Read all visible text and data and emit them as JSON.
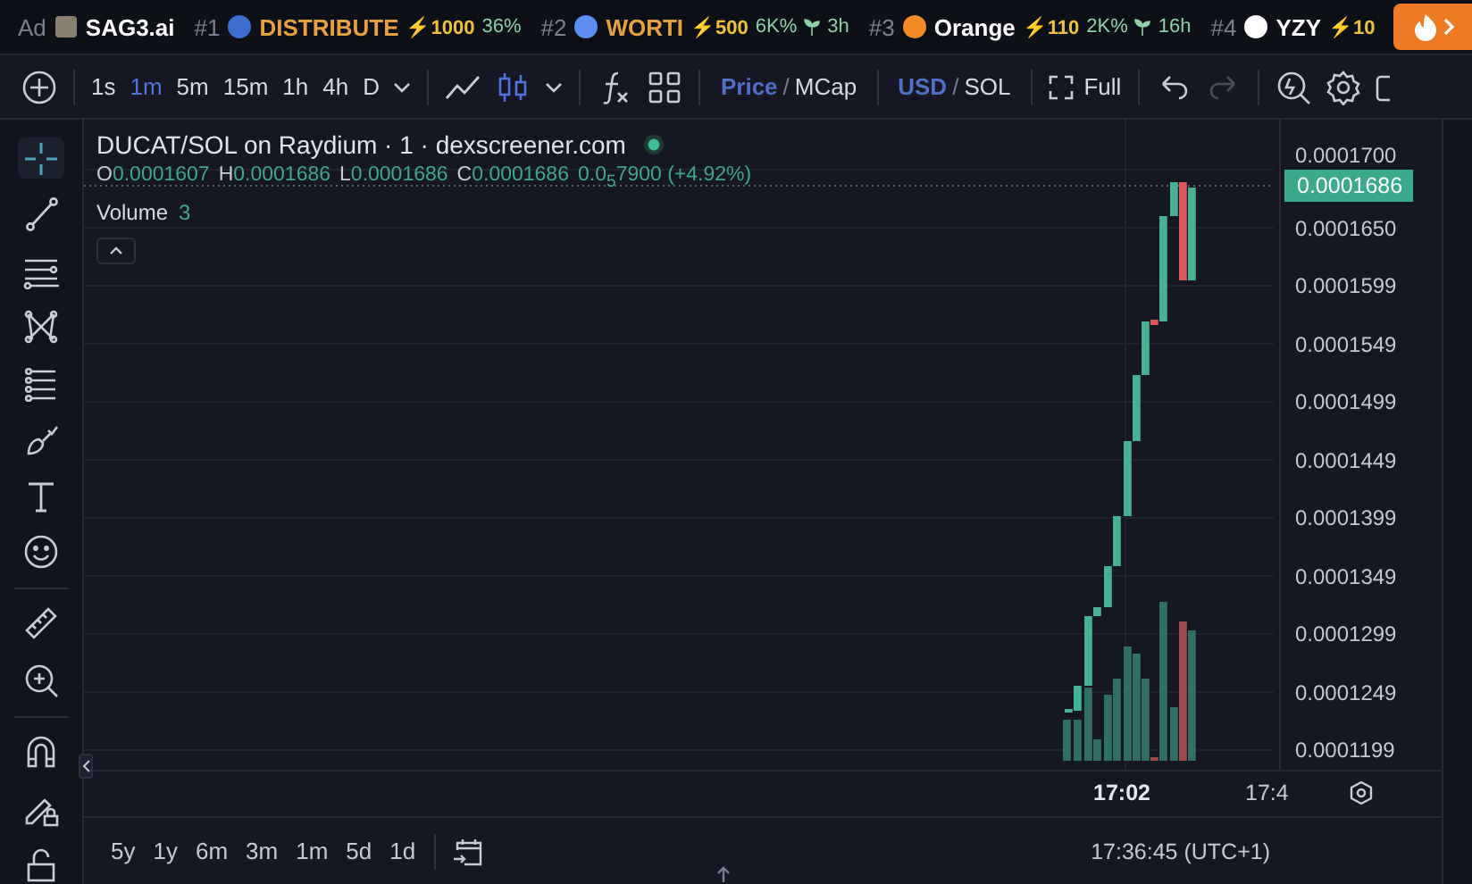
{
  "ticker": {
    "ad_label": "Ad",
    "ad_name": "SAG3.ai",
    "items": [
      {
        "rank": "#1",
        "name": "DISTRIBUTE",
        "boosted": true,
        "boost": "⚡1000",
        "change": "36%"
      },
      {
        "rank": "#2",
        "name": "WORTI",
        "boosted": true,
        "boost": "⚡500",
        "change": "6K%",
        "age": "3h"
      },
      {
        "rank": "#3",
        "name": "Orange",
        "boosted": false,
        "boost": "⚡110",
        "change": "2K%",
        "age": "16h"
      },
      {
        "rank": "#4",
        "name": "YZY",
        "boosted": false,
        "boost": "⚡10"
      }
    ]
  },
  "toolbar": {
    "intervals": [
      {
        "label": "1s",
        "selected": false
      },
      {
        "label": "1m",
        "selected": true
      },
      {
        "label": "5m",
        "selected": false
      },
      {
        "label": "15m",
        "selected": false
      },
      {
        "label": "1h",
        "selected": false
      },
      {
        "label": "4h",
        "selected": false
      },
      {
        "label": "D",
        "selected": false
      }
    ],
    "chart_types": [
      {
        "kind": "line",
        "selected": false
      },
      {
        "kind": "candles",
        "selected": true
      }
    ],
    "price_toggle": {
      "options": [
        {
          "label": "Price",
          "selected": true
        },
        {
          "label": "MCap",
          "selected": false
        }
      ],
      "separator": "/"
    },
    "currency_toggle": {
      "options": [
        {
          "label": "USD",
          "selected": true
        },
        {
          "label": "SOL",
          "selected": false
        }
      ],
      "separator": "/"
    },
    "fullscreen": "Full",
    "redo_disabled": true
  },
  "tools": [
    {
      "kind": "crosshair",
      "selected": true
    },
    {
      "kind": "trend-line",
      "selected": false
    },
    {
      "kind": "horizontal-lines",
      "selected": false
    },
    {
      "kind": "pattern",
      "selected": false
    },
    {
      "kind": "fib",
      "selected": false
    },
    {
      "kind": "brush",
      "selected": false
    },
    {
      "kind": "text",
      "selected": false
    },
    {
      "kind": "emoji",
      "selected": false
    },
    {
      "kind": "ruler",
      "selected": false
    },
    {
      "kind": "zoom",
      "selected": false
    },
    {
      "kind": "magnet",
      "selected": false
    },
    {
      "kind": "lock-drawing",
      "selected": false
    },
    {
      "kind": "lock",
      "selected": false
    }
  ],
  "legend": {
    "title": "DUCAT/SOL on Raydium · 1 · dexscreener.com",
    "live": true,
    "ohlc": [
      {
        "label": "O",
        "value": "0.0001607"
      },
      {
        "label": "H",
        "value": "0.0001686"
      },
      {
        "label": "L",
        "value": "0.0001686"
      },
      {
        "label": "C",
        "value": "0.0001686"
      }
    ],
    "change": "0.0$_{5}$7900 (+4.92%)",
    "volume_label": "Volume",
    "volume_value": "3"
  },
  "price_axis": {
    "ticks": [
      "0.0001700",
      "0.0001650",
      "0.0001599",
      "0.0001549",
      "0.0001499",
      "0.0001449",
      "0.0001399",
      "0.0001349",
      "0.0001299",
      "0.0001249",
      "0.0001199"
    ],
    "current": "0.0001686"
  },
  "time_axis": [
    {
      "text": "17:02",
      "bold": true
    },
    {
      "text": "17:4",
      "bold": false
    }
  ],
  "ranges": [
    "5y",
    "1y",
    "6m",
    "3m",
    "1m",
    "5d",
    "1d"
  ],
  "clock": "17:36:45 (UTC+1)"
}
